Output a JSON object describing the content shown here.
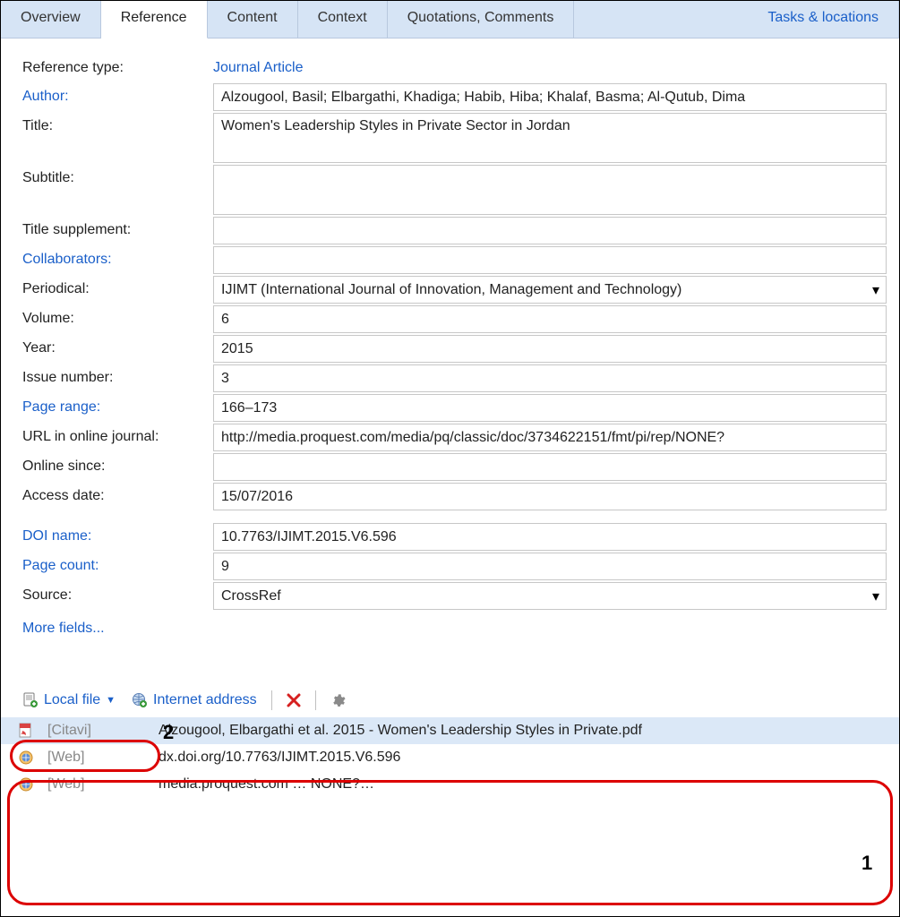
{
  "tabs": {
    "overview": "Overview",
    "reference": "Reference",
    "content": "Content",
    "context": "Context",
    "quotations": "Quotations, Comments",
    "tasks": "Tasks & locations"
  },
  "labels": {
    "reference_type": "Reference type:",
    "author": "Author:",
    "title": "Title:",
    "subtitle": "Subtitle:",
    "title_supplement": "Title supplement:",
    "collaborators": "Collaborators:",
    "periodical": "Periodical:",
    "volume": "Volume:",
    "year": "Year:",
    "issue": "Issue number:",
    "page_range": "Page range:",
    "url": "URL in online journal:",
    "online_since": "Online since:",
    "access_date": "Access date:",
    "doi": "DOI name:",
    "page_count": "Page count:",
    "source": "Source:",
    "more_fields": "More fields..."
  },
  "fields": {
    "reference_type": "Journal Article",
    "author": "Alzougool, Basil; Elbargathi, Khadiga; Habib, Hiba; Khalaf, Basma; Al-Qutub, Dima",
    "title": "Women's Leadership Styles in Private Sector in Jordan",
    "subtitle": "",
    "title_supplement": "",
    "collaborators": "",
    "periodical": "IJIMT (International Journal of Innovation, Management and Technology)",
    "volume": "6",
    "year": "2015",
    "issue": "3",
    "page_range": "166–173",
    "url": "http://media.proquest.com/media/pq/classic/doc/3734622151/fmt/pi/rep/NONE?",
    "online_since": "",
    "access_date": "15/07/2016",
    "doi": "10.7763/IJIMT.2015.V6.596",
    "page_count": "9",
    "source": "CrossRef"
  },
  "toolbar": {
    "local_file": "Local file",
    "internet_address": "Internet address"
  },
  "attachments": [
    {
      "src": "[Citavi]",
      "name": "Alzougool, Elbargathi et al. 2015 - Women's Leadership Styles in Private.pdf",
      "icon": "pdf",
      "selected": true
    },
    {
      "src": "[Web]",
      "name": "dx.doi.org/10.7763/IJIMT.2015.V6.596",
      "icon": "web",
      "selected": false
    },
    {
      "src": "[Web]",
      "name": "media.proquest.com … NONE?…",
      "icon": "web",
      "selected": false
    }
  ],
  "callouts": {
    "one": "1",
    "two": "2"
  }
}
